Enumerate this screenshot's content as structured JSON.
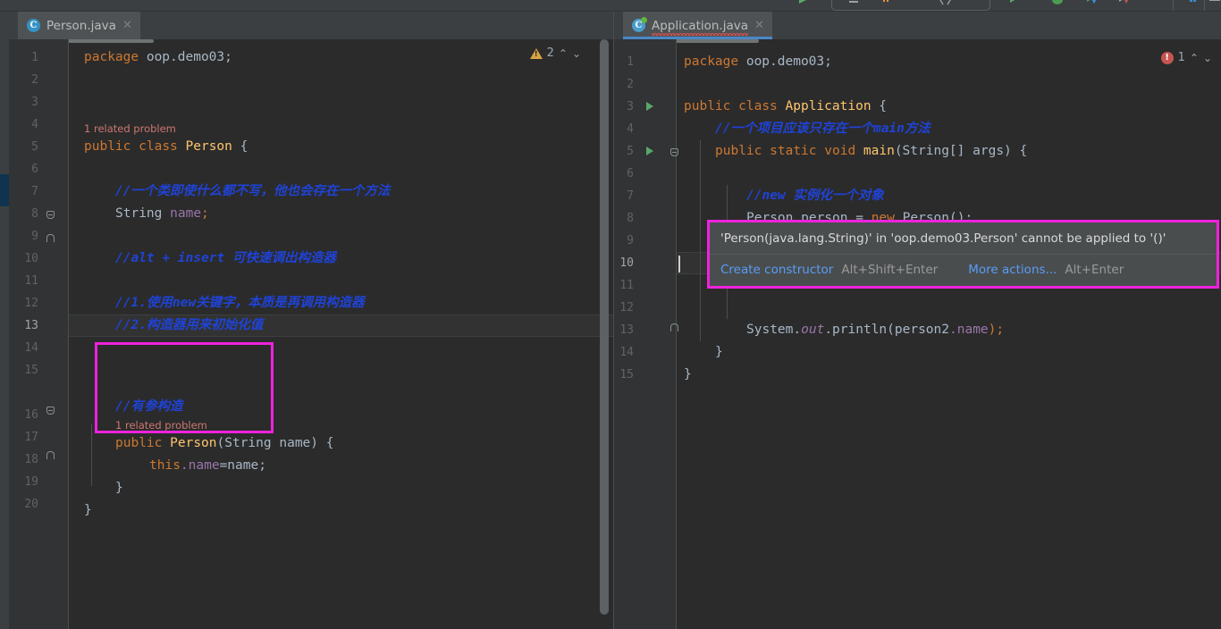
{
  "window": {
    "background": "#2b2b2b",
    "accent_magenta": "#ee22dd"
  },
  "toolbar": {
    "run_config_label": "",
    "icons": [
      "run-icon",
      "debug-icon",
      "coverage-icon",
      "profile-icon",
      "stop-icon",
      "search-icon",
      "settings-icon"
    ]
  },
  "left_editor": {
    "tab": {
      "label": "Person.java",
      "close": "✕",
      "icon": "java-class-icon"
    },
    "inspection": {
      "count": "2",
      "type": "warning",
      "up": "⌃",
      "down": "⌄"
    },
    "gutter_lines": [
      "1",
      "2",
      "3",
      "4",
      "5",
      "6",
      "7",
      "8",
      "9",
      "10",
      "11",
      "12",
      "13",
      "14",
      "15",
      "16",
      "17",
      "18",
      "19",
      "20"
    ],
    "current_line": "13",
    "lines": [
      {
        "n": 1,
        "text": "package oop.demo03;"
      },
      {
        "n": 2,
        "text": ""
      },
      {
        "n": 3,
        "text": "public class Person {"
      },
      {
        "n": 4,
        "text": ""
      },
      {
        "n": 5,
        "text": "    //一个类即使什么都不写，他也会存在一个方法"
      },
      {
        "n": 6,
        "text": "    String name;"
      },
      {
        "n": 7,
        "text": ""
      },
      {
        "n": 8,
        "text": "    //alt + insert 可快速调出构造器"
      },
      {
        "n": 9,
        "text": ""
      },
      {
        "n": 10,
        "text": "    //1.使用new关键字，本质是再调用构造器"
      },
      {
        "n": 11,
        "text": "    //2.构造器用来初始化值"
      },
      {
        "n": 12,
        "text": ""
      },
      {
        "n": 13,
        "text": ""
      },
      {
        "n": 14,
        "text": ""
      },
      {
        "n": 15,
        "text": "    //有参构造"
      },
      {
        "n": 16,
        "text": "    public Person(String name) {"
      },
      {
        "n": 17,
        "text": "        this.name=name;"
      },
      {
        "n": 18,
        "text": "    }"
      },
      {
        "n": 19,
        "text": "}"
      },
      {
        "n": 20,
        "text": ""
      }
    ],
    "hints": [
      {
        "text": "1 related problem",
        "above_line": 3
      },
      {
        "text": "1 related problem",
        "above_line": 16
      }
    ],
    "code_tokens": {
      "package_kw": "package",
      "package_name": "oop.demo03;",
      "public_kw": "public",
      "class_kw": "class",
      "class_name": "Person",
      "brace_open": "{",
      "comment_5": "//一个类即使什么都不写，他也会存在一个方法",
      "type_string": "String",
      "field_name": "name",
      "semicolon": ";",
      "comment_8": "//alt + insert 可快速调出构造器",
      "comment_10": "//1.使用new关键字，本质是再调用构造器",
      "comment_11": "//2.构造器用来初始化值",
      "comment_15": "//有参构造",
      "ctor_sig_public": "public",
      "ctor_name": "Person",
      "ctor_params": "(String name) {",
      "this_kw": "this",
      "this_field": ".name",
      "assign": "=name;",
      "close_brace_inner": "}",
      "close_brace_outer": "}"
    }
  },
  "right_editor": {
    "tab": {
      "label": "Application.java",
      "close": "✕",
      "icon": "java-class-modified-icon"
    },
    "inspection": {
      "count": "1",
      "type": "error",
      "up": "⌃",
      "down": "⌄"
    },
    "gutter_lines": [
      "1",
      "2",
      "3",
      "4",
      "5",
      "6",
      "7",
      "8",
      "9",
      "10",
      "11",
      "12",
      "13",
      "14",
      "15"
    ],
    "current_line": "10",
    "lines": [
      {
        "n": 1,
        "text": "package oop.demo03;"
      },
      {
        "n": 2,
        "text": ""
      },
      {
        "n": 3,
        "text": "public class Application {"
      },
      {
        "n": 4,
        "text": "    //一个项目应该只存在一个main方法"
      },
      {
        "n": 5,
        "text": "    public static void main(String[] args) {"
      },
      {
        "n": 6,
        "text": ""
      },
      {
        "n": 7,
        "text": "        //new 实例化一个对象"
      },
      {
        "n": 8,
        "text": "        Person person = new Person();"
      },
      {
        "n": 9,
        "text": ""
      },
      {
        "n": 10,
        "text": ""
      },
      {
        "n": 11,
        "text": ""
      },
      {
        "n": 12,
        "text": "        System.out.println(person2.name);"
      },
      {
        "n": 13,
        "text": "    }"
      },
      {
        "n": 14,
        "text": "}"
      },
      {
        "n": 15,
        "text": ""
      }
    ],
    "code_tokens": {
      "package_kw": "package",
      "package_name": "oop.demo03;",
      "public_kw": "public",
      "class_kw": "class",
      "class_name": "Application",
      "brace_open": "{",
      "comment_4": "//一个项目应该只存在一个main方法",
      "static_kw": "static",
      "void_kw": "void",
      "main_name": "main",
      "main_params": "(String[] args) {",
      "comment_7_new": "//new",
      "comment_7_rest": " 实例化一个对象",
      "person_type": "Person",
      "person_var": " person = ",
      "new_kw": "new",
      "person_ctor": " Person();",
      "system": "System.",
      "out": "out",
      "println": ".println(",
      "person2": "person2",
      "dotname": ".name",
      "close_paren": ");",
      "close_brace_inner": "}",
      "close_brace_outer": "}"
    }
  },
  "popup": {
    "message": "'Person(java.lang.String)' in 'oop.demo03.Person' cannot be applied to '()'",
    "actions": [
      {
        "label": "Create constructor",
        "shortcut": "Alt+Shift+Enter"
      },
      {
        "label": "More actions...",
        "shortcut": "Alt+Enter"
      }
    ]
  }
}
